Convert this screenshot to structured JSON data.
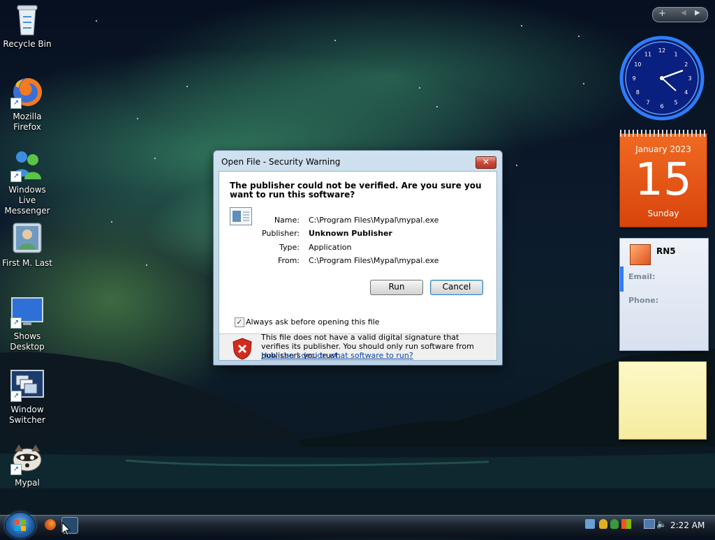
{
  "desktop": {
    "icons": [
      {
        "label": "Recycle Bin",
        "icon": "recycle-bin-icon"
      },
      {
        "label": "Mozilla\nFirefox",
        "icon": "firefox-icon"
      },
      {
        "label": "Windows Live\nMessenger",
        "icon": "messenger-icon"
      },
      {
        "label": "First M. Last",
        "icon": "user-folder-icon"
      },
      {
        "label": "Shows\nDesktop",
        "icon": "show-desktop-icon"
      },
      {
        "label": "Window\nSwitcher",
        "icon": "window-switcher-icon"
      },
      {
        "label": "Mypal",
        "icon": "mypal-icon"
      }
    ]
  },
  "dialog": {
    "title": "Open File - Security Warning",
    "close_label": "✕",
    "heading": "The publisher could not be verified.  Are you sure you want to run this software?",
    "fields": [
      {
        "label": "Name:",
        "value": "C:\\Program Files\\Mypal\\mypal.exe"
      },
      {
        "label": "Publisher:",
        "value": "Unknown Publisher"
      },
      {
        "label": "Type:",
        "value": "Application"
      },
      {
        "label": "From:",
        "value": "C:\\Program Files\\Mypal\\mypal.exe"
      }
    ],
    "run_label": "Run",
    "cancel_label": "Cancel",
    "checkbox_label": "Always ask before opening this file",
    "checkbox_checked": true,
    "warning_text": "This file does not have a valid digital signature that verifies its publisher.  You should only run software from publishers you trust.",
    "warning_link": "How can I decide what software to run?"
  },
  "gadgets": {
    "calendar": {
      "month": "January 2023",
      "day": "15",
      "weekday": "Sunday"
    },
    "contact": {
      "name": "RN5",
      "email_label": "Email:",
      "phone_label": "Phone:"
    },
    "clock_numbers": [
      "12",
      "1",
      "2",
      "3",
      "4",
      "5",
      "6",
      "7",
      "8",
      "9",
      "10",
      "11"
    ]
  },
  "taskbar": {
    "time": "2:22 AM"
  },
  "colors": {
    "dialog_link": "#0645ad",
    "calendar_orange": "#e8561a",
    "clock_ring": "#1e6cff"
  }
}
